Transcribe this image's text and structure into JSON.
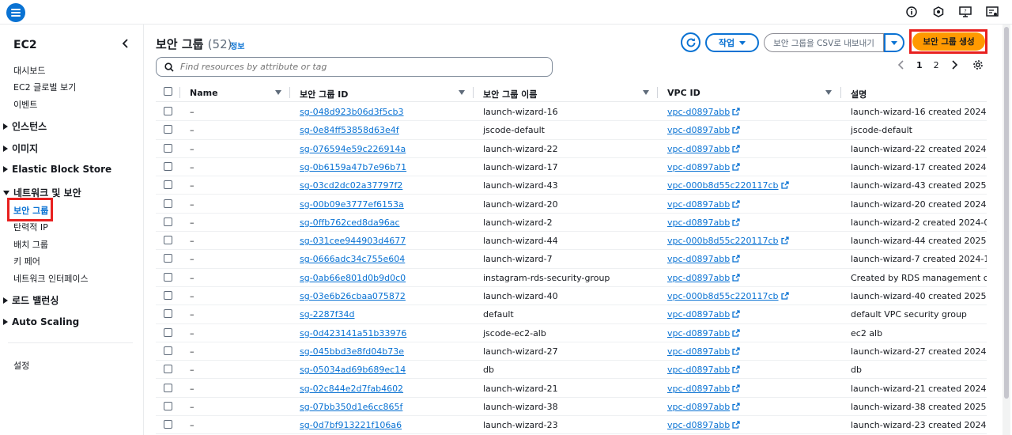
{
  "sidebar": {
    "title": "EC2",
    "links_top": [
      "대시보드",
      "EC2 글로벌 보기",
      "이벤트"
    ],
    "sections": [
      "인스턴스",
      "이미지",
      "Elastic Block Store",
      "네트워크 및 보안",
      "로드 밸런싱",
      "Auto Scaling"
    ],
    "network_items": [
      "보안 그룹",
      "탄력적 IP",
      "배치 그룹",
      "키 페어",
      "네트워크 인터페이스"
    ],
    "settings": "설정"
  },
  "header": {
    "title": "보안 그룹",
    "count": "(52)",
    "info": "정보",
    "actions_label": "작업",
    "export_label": "보안 그룹을 CSV로 내보내기",
    "create_label": "보안 그룹 생성"
  },
  "search": {
    "placeholder": "Find resources by attribute or tag"
  },
  "pagination": {
    "pages": [
      "1",
      "2"
    ],
    "current": "1"
  },
  "table": {
    "columns": [
      "Name",
      "보안 그룹 ID",
      "보안 그룹 이름",
      "VPC ID",
      "설명"
    ],
    "rows": [
      {
        "name": "–",
        "id": "sg-048d923b06d3f5cb3",
        "group_name": "launch-wizard-16",
        "vpc": "vpc-d0897abb",
        "desc": "launch-wizard-16 created 2024-12"
      },
      {
        "name": "–",
        "id": "sg-0e84ff53858d63e4f",
        "group_name": "jscode-default",
        "vpc": "vpc-d0897abb",
        "desc": "jscode-default"
      },
      {
        "name": "–",
        "id": "sg-076594e59c226914a",
        "group_name": "launch-wizard-22",
        "vpc": "vpc-d0897abb",
        "desc": "launch-wizard-22 created 2024-12"
      },
      {
        "name": "–",
        "id": "sg-0b6159a47b7e96b71",
        "group_name": "launch-wizard-17",
        "vpc": "vpc-d0897abb",
        "desc": "launch-wizard-17 created 2024-12"
      },
      {
        "name": "–",
        "id": "sg-03cd2dc02a37797f2",
        "group_name": "launch-wizard-43",
        "vpc": "vpc-000b8d55c220117cb",
        "desc": "launch-wizard-43 created 2025-03"
      },
      {
        "name": "–",
        "id": "sg-00b09e3777ef6153a",
        "group_name": "launch-wizard-20",
        "vpc": "vpc-d0897abb",
        "desc": "launch-wizard-20 created 2024-12"
      },
      {
        "name": "–",
        "id": "sg-0ffb762ced8da96ac",
        "group_name": "launch-wizard-2",
        "vpc": "vpc-d0897abb",
        "desc": "launch-wizard-2 created 2024-08-1"
      },
      {
        "name": "–",
        "id": "sg-031cee944903d4677",
        "group_name": "launch-wizard-44",
        "vpc": "vpc-000b8d55c220117cb",
        "desc": "launch-wizard-44 created 2025-03"
      },
      {
        "name": "–",
        "id": "sg-0666adc34c755e604",
        "group_name": "launch-wizard-7",
        "vpc": "vpc-d0897abb",
        "desc": "launch-wizard-7 created 2024-11-0"
      },
      {
        "name": "–",
        "id": "sg-0ab66e801d0b9d0c0",
        "group_name": "instagram-rds-security-group",
        "vpc": "vpc-d0897abb",
        "desc": "Created by RDS management conso"
      },
      {
        "name": "–",
        "id": "sg-03e6b26cbaa075872",
        "group_name": "launch-wizard-40",
        "vpc": "vpc-000b8d55c220117cb",
        "desc": "launch-wizard-40 created 2025-03"
      },
      {
        "name": "–",
        "id": "sg-2287f34d",
        "group_name": "default",
        "vpc": "vpc-d0897abb",
        "desc": "default VPC security group"
      },
      {
        "name": "–",
        "id": "sg-0d423141a51b33976",
        "group_name": "jscode-ec2-alb",
        "vpc": "vpc-d0897abb",
        "desc": "ec2 alb"
      },
      {
        "name": "–",
        "id": "sg-045bbd3e8fd04b73e",
        "group_name": "launch-wizard-27",
        "vpc": "vpc-d0897abb",
        "desc": "launch-wizard-27 created 2024-12"
      },
      {
        "name": "–",
        "id": "sg-05034ad69b689ec14",
        "group_name": "db",
        "vpc": "vpc-d0897abb",
        "desc": "db"
      },
      {
        "name": "–",
        "id": "sg-02c844e2d7fab4602",
        "group_name": "launch-wizard-21",
        "vpc": "vpc-d0897abb",
        "desc": "launch-wizard-21 created 2024-12"
      },
      {
        "name": "–",
        "id": "sg-07bb350d1e6cc865f",
        "group_name": "launch-wizard-38",
        "vpc": "vpc-d0897abb",
        "desc": "launch-wizard-38 created 2025-03"
      },
      {
        "name": "–",
        "id": "sg-0d7bf913221f106a6",
        "group_name": "launch-wizard-23",
        "vpc": "vpc-d0897abb",
        "desc": "launch-wizard-23 created 2024-12"
      }
    ]
  },
  "icons": {
    "menu": "hamburger-icon",
    "top": [
      "info-icon",
      "notifications-icon",
      "support-icon",
      "settings-icon"
    ],
    "external": "external-link-icon"
  },
  "colors": {
    "accent": "#0972d3",
    "primary_button": "#ff9900",
    "highlight_box": "#e8201f"
  }
}
